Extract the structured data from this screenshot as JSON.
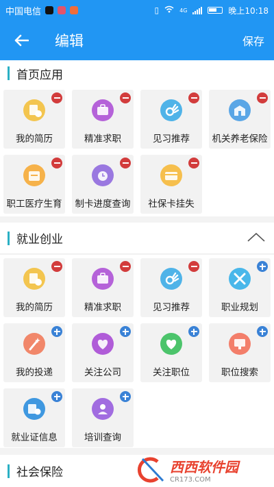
{
  "status_bar": {
    "carrier": "中国电信",
    "time": "晚上10:18",
    "network": "4G"
  },
  "header": {
    "title": "编辑",
    "save_label": "保存"
  },
  "sections": [
    {
      "title": "首页应用",
      "tiles": [
        {
          "label": "我的简历",
          "icon": "resume-icon",
          "color": "#f3c54f",
          "badge": "minus"
        },
        {
          "label": "精准求职",
          "icon": "briefcase-icon",
          "color": "#b562d9",
          "badge": "minus"
        },
        {
          "label": "见习推荐",
          "icon": "ok-hand-icon",
          "color": "#4fb3e8",
          "badge": "minus"
        },
        {
          "label": "机关养老保险",
          "icon": "building-icon",
          "color": "#5aa6e6",
          "badge": "minus"
        },
        {
          "label": "职工医疗生育",
          "icon": "medical-box-icon",
          "color": "#f6b24a",
          "badge": "minus"
        },
        {
          "label": "制卡进度查询",
          "icon": "alarm-clock-icon",
          "color": "#9a78e0",
          "badge": "minus"
        },
        {
          "label": "社保卡挂失",
          "icon": "card-icon",
          "color": "#f6bf4d",
          "badge": "minus"
        }
      ]
    },
    {
      "title": "就业创业",
      "tiles": [
        {
          "label": "我的简历",
          "icon": "resume-icon",
          "color": "#f3c54f",
          "badge": "minus"
        },
        {
          "label": "精准求职",
          "icon": "briefcase-icon",
          "color": "#b562d9",
          "badge": "minus"
        },
        {
          "label": "见习推荐",
          "icon": "ok-hand-icon",
          "color": "#4fb3e8",
          "badge": "minus"
        },
        {
          "label": "职业规划",
          "icon": "tools-icon",
          "color": "#49b7ea",
          "badge": "plus"
        },
        {
          "label": "我的投递",
          "icon": "wand-icon",
          "color": "#f1876a",
          "badge": "plus"
        },
        {
          "label": "关注公司",
          "icon": "heart-home-icon",
          "color": "#b05cd8",
          "badge": "plus"
        },
        {
          "label": "关注职位",
          "icon": "heart-icon",
          "color": "#4cc46b",
          "badge": "plus"
        },
        {
          "label": "职位搜索",
          "icon": "monitor-icon",
          "color": "#f37e6a",
          "badge": "plus"
        },
        {
          "label": "就业证信息",
          "icon": "id-card-icon",
          "color": "#3f98e0",
          "badge": "plus"
        },
        {
          "label": "培训查询",
          "icon": "training-icon",
          "color": "#a16ce0",
          "badge": "plus"
        }
      ]
    },
    {
      "title": "社会保险",
      "tiles": []
    }
  ],
  "watermark": {
    "brand": "西西软件园",
    "domain": "CR173.COM"
  }
}
